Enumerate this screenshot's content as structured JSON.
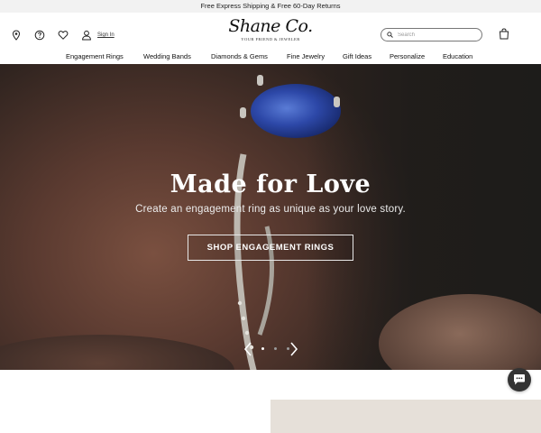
{
  "promo": {
    "text": "Free Express Shipping & Free 60-Day Returns"
  },
  "header": {
    "logo_name": "Shane Co.",
    "logo_tagline": "YOUR FRIEND & JEWELER",
    "signin_label": "Sign In",
    "search_placeholder": "Search",
    "icons": [
      "location-pin-icon",
      "help-icon",
      "heart-icon",
      "user-icon",
      "search-icon",
      "shopping-bag-icon"
    ]
  },
  "nav": {
    "items": [
      "Engagement Rings",
      "Wedding Bands",
      "Diamonds & Gems",
      "Fine Jewelry",
      "Gift Ideas",
      "Personalize",
      "Education"
    ]
  },
  "hero": {
    "title": "Made for Love",
    "subtitle": "Create an engagement ring as unique as your love story.",
    "cta_label": "SHOP ENGAGEMENT RINGS",
    "slide_count": 3,
    "active_slide": 1
  },
  "chat": {
    "icon": "chat-bubble-icon"
  }
}
